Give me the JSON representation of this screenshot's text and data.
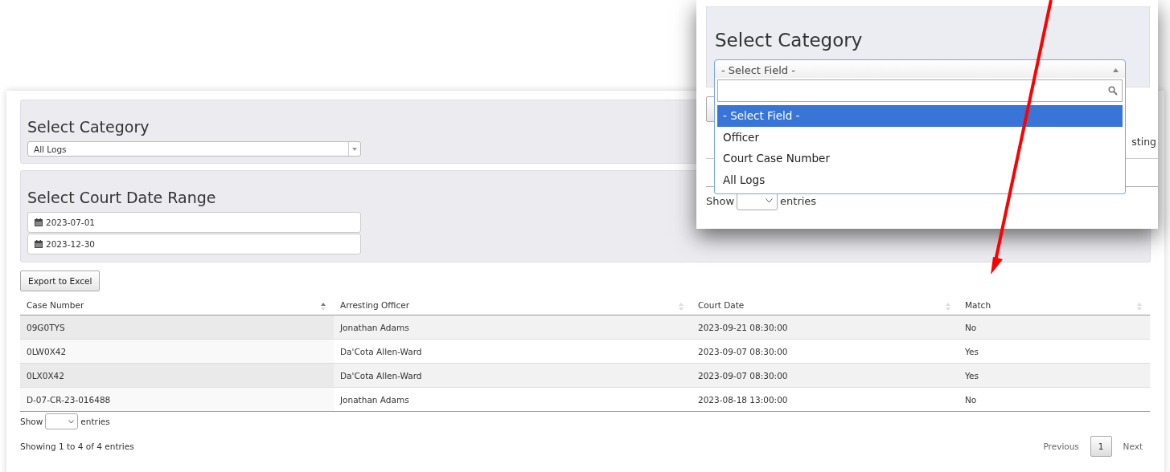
{
  "category_panel": {
    "title": "Select Category",
    "value": "All Logs"
  },
  "date_panel": {
    "title": "Select Court Date Range",
    "dates": [
      "2023-07-01",
      "2023-12-30"
    ]
  },
  "export_button": "Export to Excel",
  "table": {
    "columns": [
      {
        "label": "Case Number",
        "sorted": true
      },
      {
        "label": "Arresting Officer",
        "sorted": false
      },
      {
        "label": "Court Date",
        "sorted": false
      },
      {
        "label": "Match",
        "sorted": false
      }
    ],
    "rows": [
      [
        "09G0TYS",
        "Jonathan Adams",
        "2023-09-21 08:30:00",
        "No"
      ],
      [
        "0LW0X42",
        "Da'Cota Allen-Ward",
        "2023-09-07 08:30:00",
        "Yes"
      ],
      [
        "0LX0X42",
        "Da'Cota Allen-Ward",
        "2023-09-07 08:30:00",
        "Yes"
      ],
      [
        "D-07-CR-23-016488",
        "Jonathan Adams",
        "2023-08-18 13:00:00",
        "No"
      ]
    ]
  },
  "length_menu": {
    "before": "Show",
    "after": "entries"
  },
  "info": "Showing 1 to 4 of 4 entries",
  "pagination": [
    {
      "label": "Previous",
      "selected": false
    },
    {
      "label": "1",
      "selected": true
    },
    {
      "label": "Next",
      "selected": false
    }
  ],
  "inset": {
    "title": "Select Category",
    "value": "- Select Field -",
    "behind_text": "sting",
    "length_menu": {
      "before": "Show",
      "after": "entries"
    },
    "options": [
      {
        "label": "- Select Field -",
        "selected": true
      },
      {
        "label": "Officer",
        "selected": false
      },
      {
        "label": "Court Case Number",
        "selected": false
      },
      {
        "label": "All Logs",
        "selected": false
      }
    ]
  }
}
